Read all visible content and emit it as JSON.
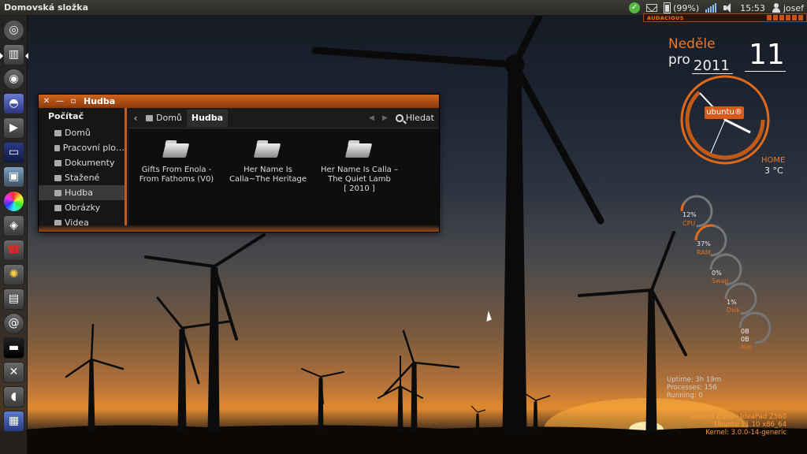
{
  "top_panel": {
    "title": "Domovská složka",
    "battery": "(99%)",
    "time": "15:53",
    "user": "josef"
  },
  "audacious": {
    "label": "AUDACIOUS"
  },
  "launcher": {
    "items": [
      "ubuntu-logo-icon",
      "files-icon",
      "disc-icon",
      "hat-icon",
      "media-player-icon",
      "monitor-icon",
      "photos-icon",
      "color-wheel-icon",
      "tools-icon",
      "phone-icon",
      "bulb-icon",
      "terminal-icon",
      "swirl-icon",
      "window-icon",
      "settings-icon",
      "mouse-icon",
      "trash-icon"
    ]
  },
  "window": {
    "title": "Hudba",
    "sidebar": {
      "heading": "Počítač",
      "items": [
        "Domů",
        "Pracovní plo…",
        "Dokumenty",
        "Stažené",
        "Hudba",
        "Obrázky",
        "Videa"
      ],
      "selected": "Hudba"
    },
    "breadcrumbs": [
      "Domů",
      "Hudba"
    ],
    "search_label": "Hledat",
    "files": [
      {
        "line1": "Gifts From Enola -",
        "line2": "From Fathoms (V0)",
        "line3": ""
      },
      {
        "line1": "Her Name Is",
        "line2": "Calla~The Heritage",
        "line3": ""
      },
      {
        "line1": "Her Name Is Calla –",
        "line2": "The Quiet Lamb",
        "line3": "[ 2010 ]"
      }
    ]
  },
  "conky": {
    "day_name": "Neděle",
    "month": "pro",
    "year": "2011",
    "day": "11",
    "clock_badge": "ubuntu®",
    "location": "HOME",
    "temperature": "3 °C",
    "meters": [
      {
        "value": "12%",
        "label": "CPU",
        "fraction": 0.12
      },
      {
        "value": "37%",
        "label": "RAM",
        "fraction": 0.37
      },
      {
        "value": "0%",
        "label": "Swap",
        "fraction": 0.0
      },
      {
        "value": "1%",
        "label": "Disk",
        "fraction": 0.01
      },
      {
        "value": "0B",
        "value2": "0B",
        "label": "Net",
        "fraction": 0.0
      }
    ],
    "uptime": "Uptime: 3h 19m",
    "processes": "Processes: 156",
    "running": "Running: 0",
    "machine": "Lenovo B560 - IdeaPad Z560",
    "os": "Ubuntu 11.10  x86_64",
    "kernel": "Kernel: 3.0.0-14-generic"
  },
  "colors": {
    "accent": "#d65a1a",
    "panel": "#3c3b37"
  }
}
